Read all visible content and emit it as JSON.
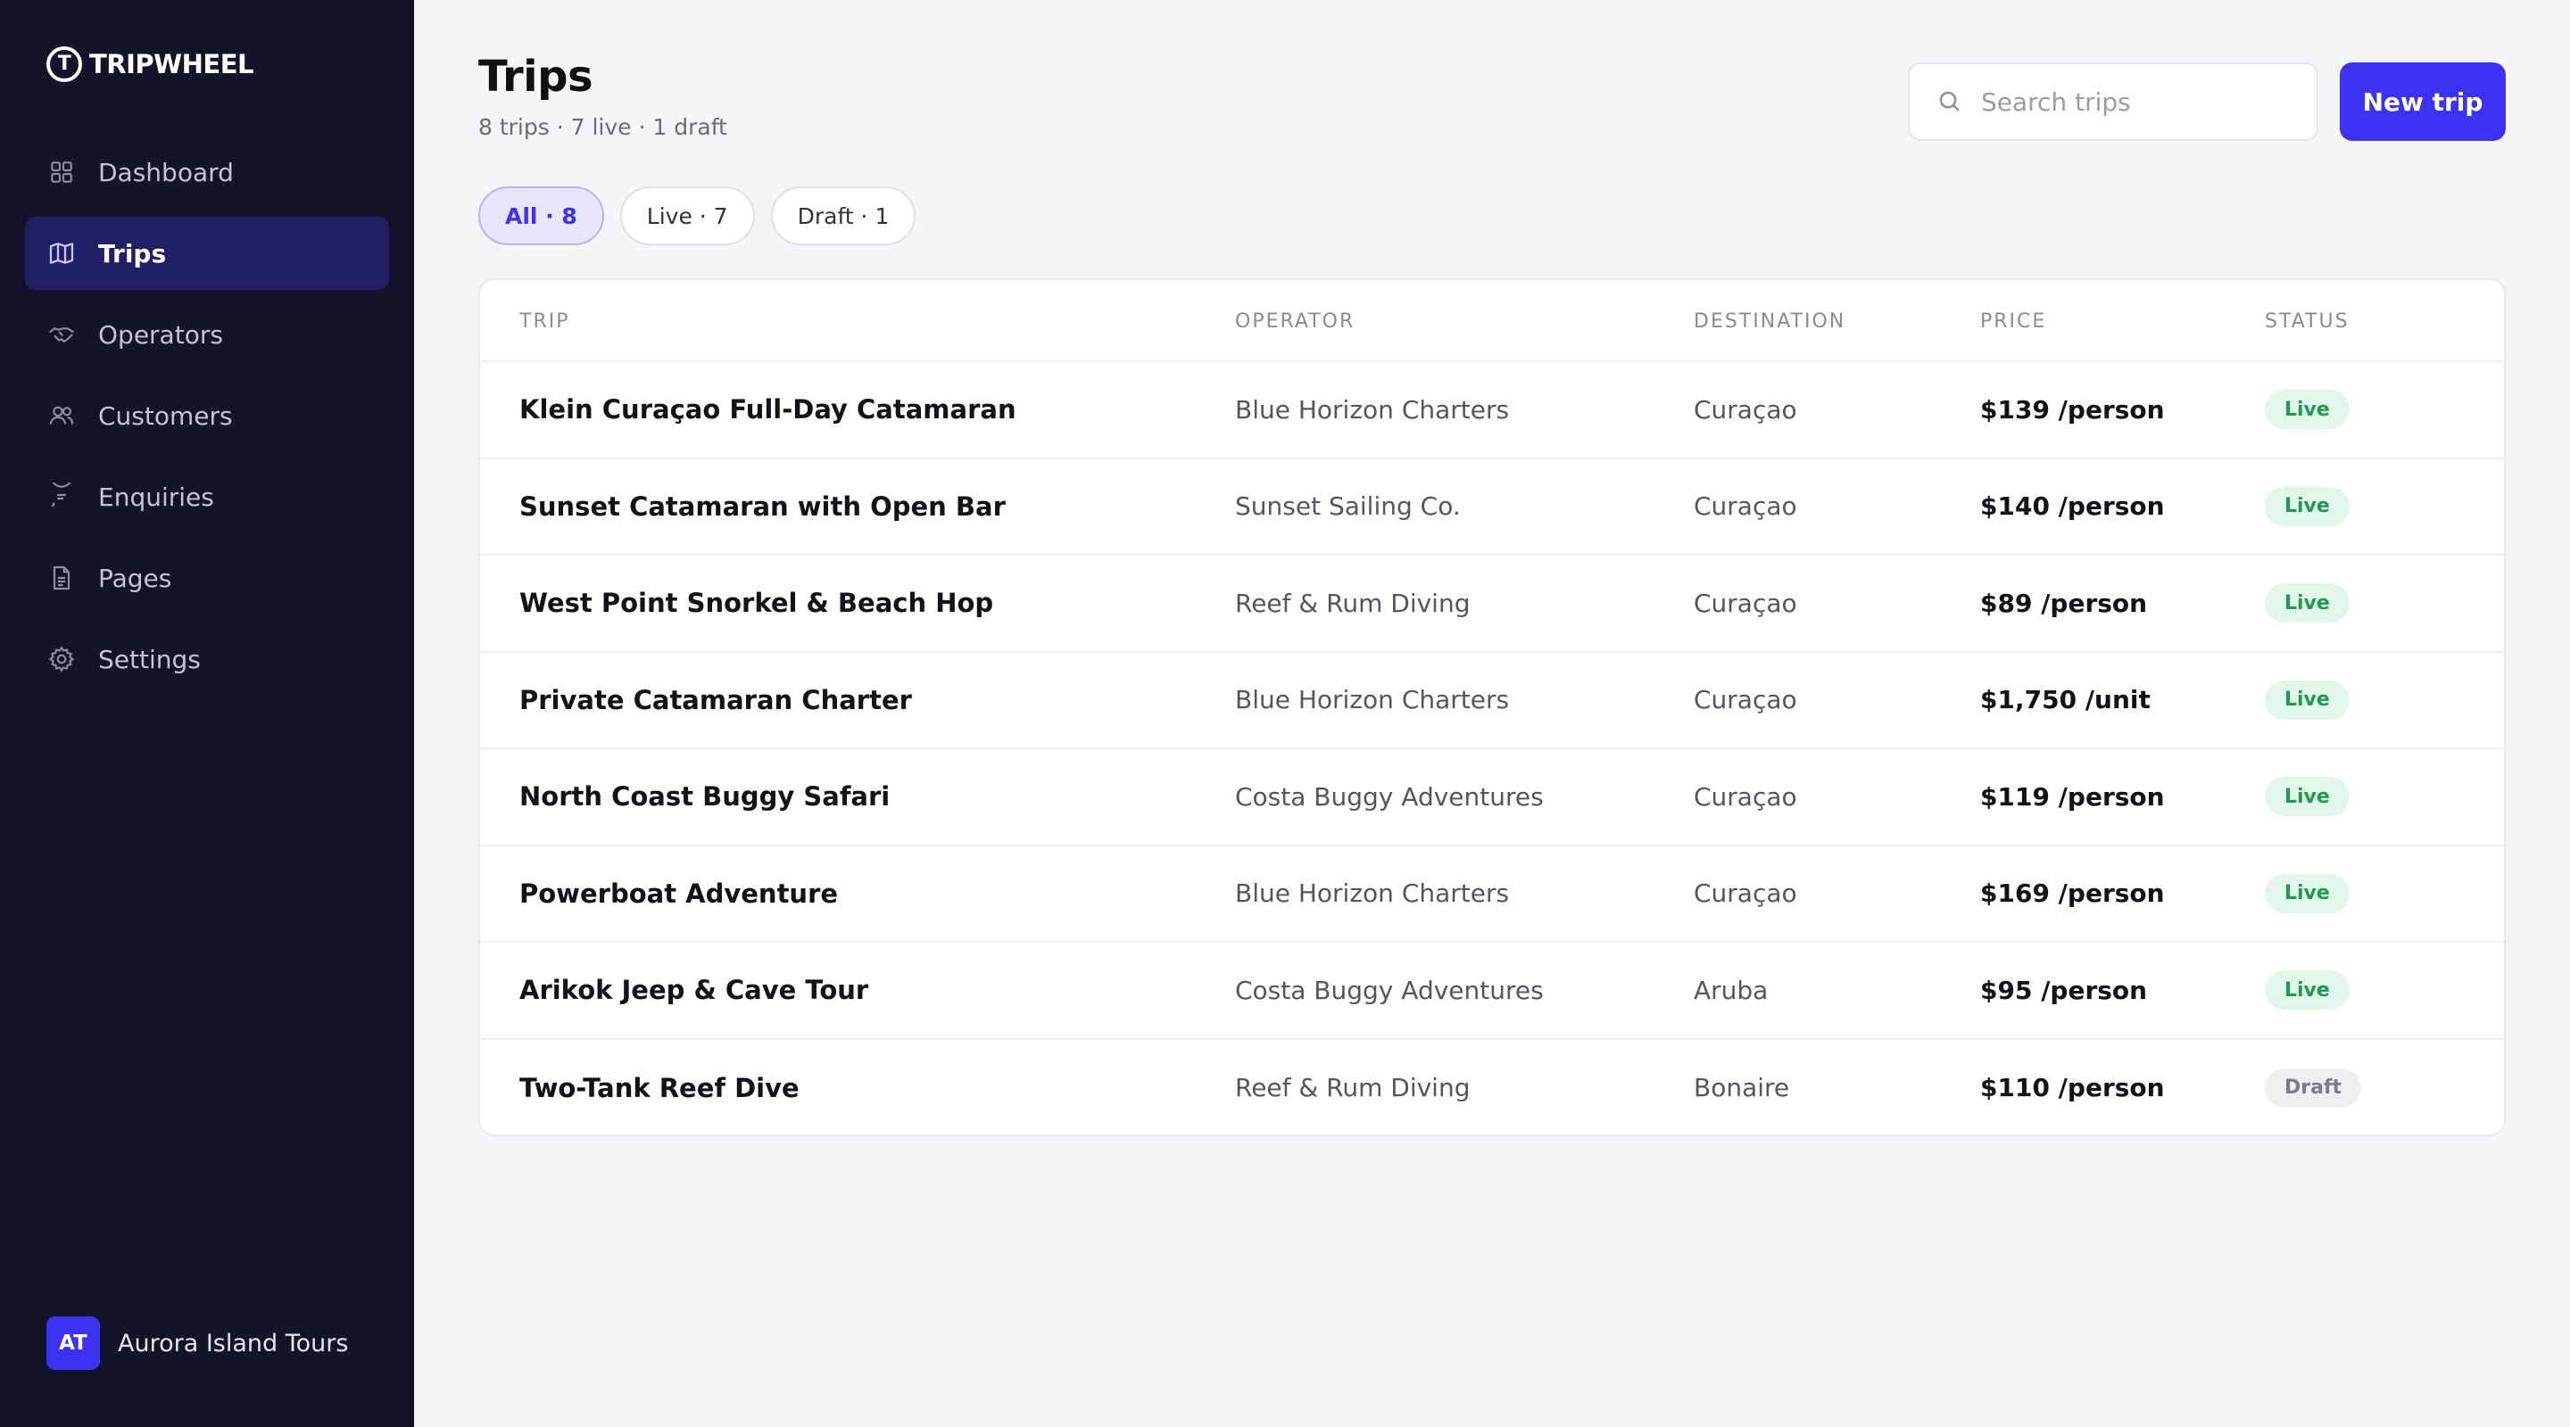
{
  "brand": {
    "name": "TRIPWHEEL",
    "logo_letter": "T"
  },
  "nav": [
    {
      "label": "Dashboard",
      "icon": "grid-icon",
      "active": false
    },
    {
      "label": "Trips",
      "icon": "map-icon",
      "active": true
    },
    {
      "label": "Operators",
      "icon": "handshake-icon",
      "active": false
    },
    {
      "label": "Customers",
      "icon": "users-icon",
      "active": false
    },
    {
      "label": "Enquiries",
      "icon": "chat-icon",
      "active": false
    },
    {
      "label": "Pages",
      "icon": "file-icon",
      "active": false
    },
    {
      "label": "Settings",
      "icon": "gear-icon",
      "active": false
    }
  ],
  "account": {
    "initials": "AT",
    "name": "Aurora Island Tours"
  },
  "header": {
    "title": "Trips",
    "subtitle": "8 trips · 7 live · 1 draft",
    "search_placeholder": "Search trips",
    "new_button": "New trip"
  },
  "filters": [
    {
      "label": "All · 8",
      "active": true
    },
    {
      "label": "Live · 7",
      "active": false
    },
    {
      "label": "Draft · 1",
      "active": false
    }
  ],
  "table": {
    "columns": [
      "TRIP",
      "OPERATOR",
      "DESTINATION",
      "PRICE",
      "STATUS"
    ],
    "rows": [
      {
        "trip": "Klein Curaçao Full-Day Catamaran",
        "operator": "Blue Horizon Charters",
        "destination": "Curaçao",
        "price": "$139 /person",
        "status": "Live"
      },
      {
        "trip": "Sunset Catamaran with Open Bar",
        "operator": "Sunset Sailing Co.",
        "destination": "Curaçao",
        "price": "$140 /person",
        "status": "Live"
      },
      {
        "trip": "West Point Snorkel & Beach Hop",
        "operator": "Reef & Rum Diving",
        "destination": "Curaçao",
        "price": "$89 /person",
        "status": "Live"
      },
      {
        "trip": "Private Catamaran Charter",
        "operator": "Blue Horizon Charters",
        "destination": "Curaçao",
        "price": "$1,750 /unit",
        "status": "Live"
      },
      {
        "trip": "North Coast Buggy Safari",
        "operator": "Costa Buggy Adventures",
        "destination": "Curaçao",
        "price": "$119 /person",
        "status": "Live"
      },
      {
        "trip": "Powerboat Adventure",
        "operator": "Blue Horizon Charters",
        "destination": "Curaçao",
        "price": "$169 /person",
        "status": "Live"
      },
      {
        "trip": "Arikok Jeep & Cave Tour",
        "operator": "Costa Buggy Adventures",
        "destination": "Aruba",
        "price": "$95 /person",
        "status": "Live"
      },
      {
        "trip": "Two-Tank Reef Dive",
        "operator": "Reef & Rum Diving",
        "destination": "Bonaire",
        "price": "$110 /person",
        "status": "Draft"
      }
    ]
  },
  "colors": {
    "sidebar_bg": "#13132a",
    "accent": "#3b33f1",
    "live_badge": "#1f9a53",
    "draft_badge": "#7b7b88"
  }
}
